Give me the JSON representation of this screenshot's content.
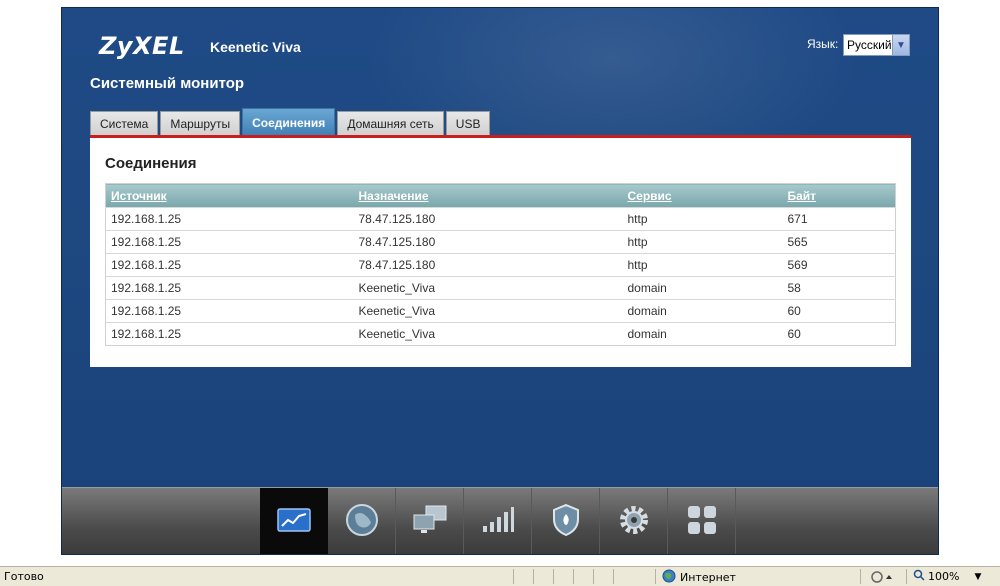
{
  "header": {
    "logo": "ZyXEL",
    "model": "Keenetic Viva",
    "language_label": "Язык:",
    "language_value": "Русский"
  },
  "page_title": "Системный монитор",
  "tabs": [
    {
      "label": "Система",
      "active": false
    },
    {
      "label": "Маршруты",
      "active": false
    },
    {
      "label": "Соединения",
      "active": true
    },
    {
      "label": "Домашняя сеть",
      "active": false
    },
    {
      "label": "USB",
      "active": false
    }
  ],
  "section": {
    "title": "Соединения",
    "columns": [
      "Источник",
      "Назначение",
      "Сервис",
      "Байт"
    ],
    "rows": [
      [
        "192.168.1.25",
        "78.47.125.180",
        "http",
        "671"
      ],
      [
        "192.168.1.25",
        "78.47.125.180",
        "http",
        "565"
      ],
      [
        "192.168.1.25",
        "78.47.125.180",
        "http",
        "569"
      ],
      [
        "192.168.1.25",
        "Keenetic_Viva",
        "domain",
        "58"
      ],
      [
        "192.168.1.25",
        "Keenetic_Viva",
        "domain",
        "60"
      ],
      [
        "192.168.1.25",
        "Keenetic_Viva",
        "domain",
        "60"
      ]
    ]
  },
  "bottom_nav": [
    {
      "icon": "monitor-chart-icon",
      "active": true
    },
    {
      "icon": "globe-internet-icon",
      "active": false
    },
    {
      "icon": "home-network-computers-icon",
      "active": false
    },
    {
      "icon": "wifi-signal-bars-icon",
      "active": false
    },
    {
      "icon": "security-shield-icon",
      "active": false
    },
    {
      "icon": "system-gear-icon",
      "active": false
    },
    {
      "icon": "apps-grid-icon",
      "active": false
    }
  ],
  "statusbar": {
    "status": "Готово",
    "zone": "Интернет",
    "zoom": "100%"
  },
  "colors": {
    "app_bg": "#1d4880",
    "active_tab": "#4f8fc4",
    "table_header": "#8fb8bc",
    "accent_line": "#c81e1e"
  }
}
